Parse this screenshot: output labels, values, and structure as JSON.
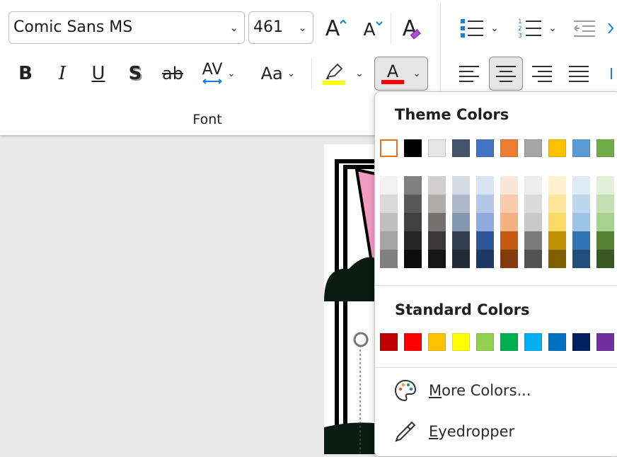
{
  "font_group": {
    "font_name": "Comic Sans MS",
    "font_size": "461",
    "group_label": "Font",
    "bold_label": "B",
    "italic_label": "I",
    "underline_label": "U",
    "shadow_label": "S",
    "strike_label": "ab",
    "spacing_label": "AV",
    "case_label": "Aa",
    "grow_label": "A",
    "shrink_label": "A",
    "clear_label": "A",
    "font_color_label": "A",
    "highlight_color": "#ffff00",
    "font_color": "#ff0000"
  },
  "color_menu": {
    "theme_title": "Theme Colors",
    "standard_title": "Standard Colors",
    "more_colors_prefix": "M",
    "more_colors_rest": "ore Colors...",
    "eyedropper_prefix": "E",
    "eyedropper_rest": "yedropper",
    "theme_top": [
      "#ffffff",
      "#000000",
      "#e7e6e6",
      "#44546a",
      "#4472c4",
      "#ed7d31",
      "#a5a5a5",
      "#ffc000",
      "#5b9bd5",
      "#70ad47"
    ],
    "theme_shades": [
      [
        "#f2f2f2",
        "#d9d9d9",
        "#bfbfbf",
        "#a6a6a6",
        "#808080"
      ],
      [
        "#808080",
        "#595959",
        "#404040",
        "#262626",
        "#0d0d0d"
      ],
      [
        "#d0cece",
        "#aeabab",
        "#757171",
        "#3a3838",
        "#171616"
      ],
      [
        "#d6dce5",
        "#adb9ca",
        "#8497b0",
        "#333f50",
        "#222a35"
      ],
      [
        "#dae3f3",
        "#b4c7e7",
        "#8faadc",
        "#2f5597",
        "#1f3864"
      ],
      [
        "#fbe5d6",
        "#f8cbad",
        "#f4b183",
        "#c55a11",
        "#843c0c"
      ],
      [
        "#ededed",
        "#dbdbdb",
        "#c9c9c9",
        "#7b7b7b",
        "#525252"
      ],
      [
        "#fff2cc",
        "#ffe699",
        "#ffd966",
        "#bf9000",
        "#7f6000"
      ],
      [
        "#deebf7",
        "#bdd7ee",
        "#9dc3e6",
        "#2e75b6",
        "#1f4e79"
      ],
      [
        "#e2f0d9",
        "#c5e0b4",
        "#a9d18e",
        "#548235",
        "#385723"
      ]
    ],
    "standard": [
      "#c00000",
      "#ff0000",
      "#ffc000",
      "#ffff00",
      "#92d050",
      "#00b050",
      "#00b0f0",
      "#0070c0",
      "#002060",
      "#7030a0"
    ]
  }
}
